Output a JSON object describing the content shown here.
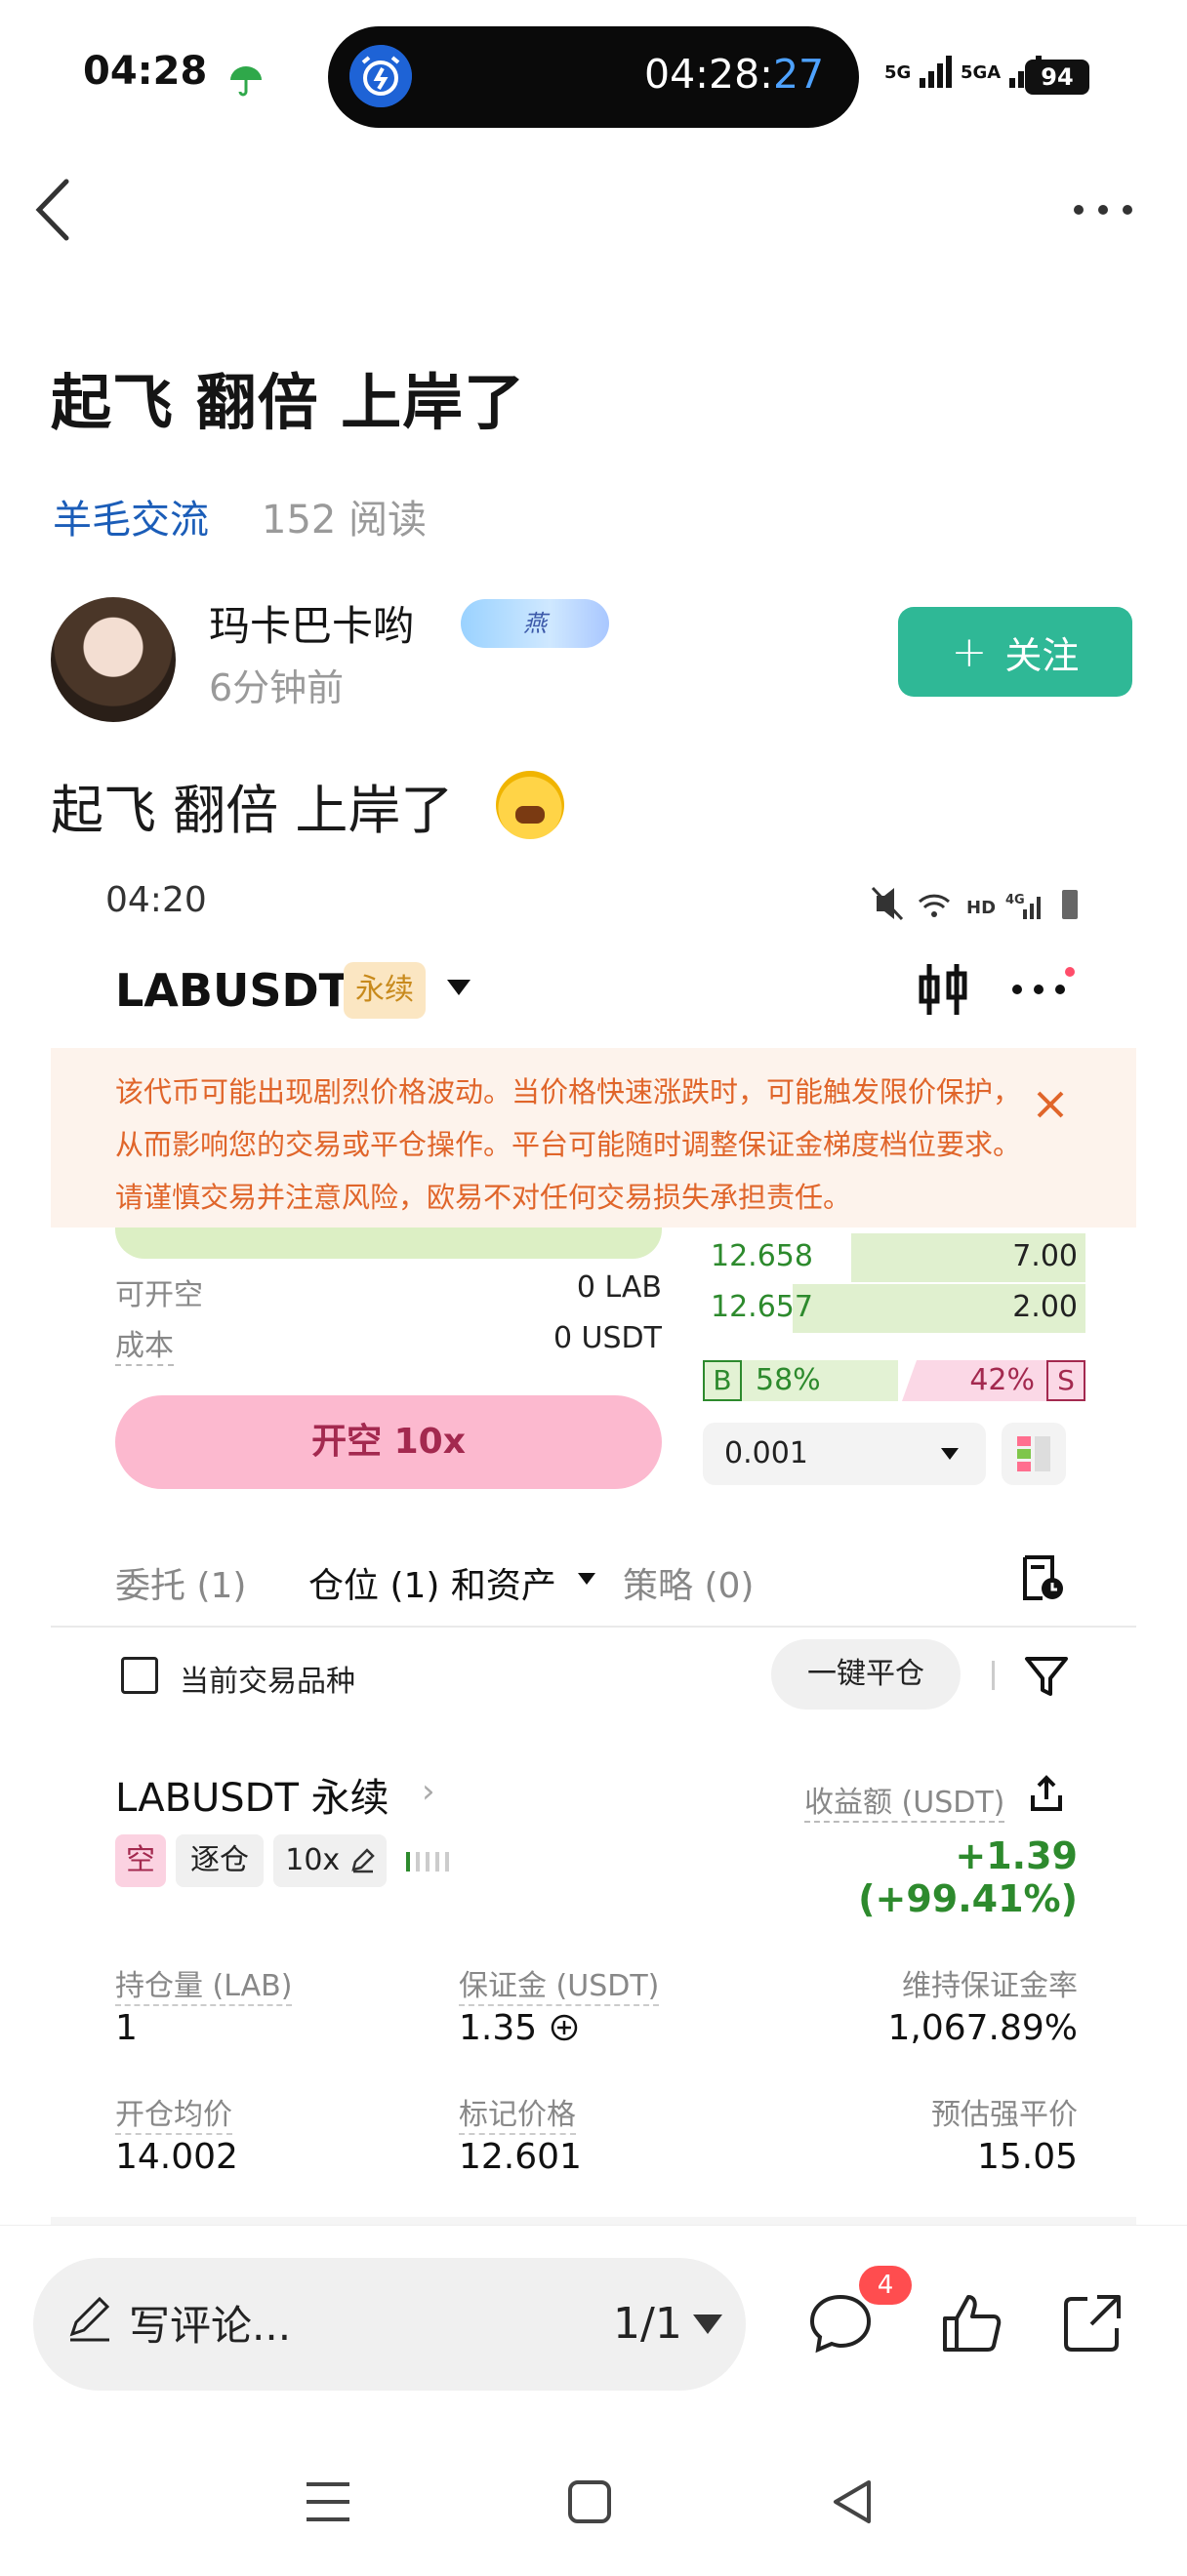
{
  "status_bar": {
    "time": "04:28",
    "island_time_prefix": "04:28:",
    "island_time_seconds": "27",
    "signal_1": "5G",
    "signal_2": "5GA",
    "battery": "94"
  },
  "post": {
    "title": "起飞 翻倍 上岸了",
    "category": "羊毛交流",
    "reads": "152 阅读",
    "author": "玛卡巴卡哟",
    "author_badge": "燕",
    "time_ago": "6分钟前",
    "follow_label": "关注",
    "body": "起飞 翻倍 上岸了"
  },
  "screenshot": {
    "time": "04:20",
    "pair": "LABUSDT",
    "perp_tag": "永续",
    "warning": "该代币可能出现剧烈价格波动。当价格快速涨跌时，可能触发限价保护，从而影响您的交易或平仓操作。平台可能随时调整保证金梯度档位要求。请谨慎交易并注意风险，欧易不对任何交易损失承担责任。",
    "orderbook": [
      {
        "price": "12.658",
        "qty": "7.00",
        "depth": 0.45
      },
      {
        "price": "12.657",
        "qty": "2.00",
        "depth": 0.6
      }
    ],
    "available_short_label": "可开空",
    "available_short_value": "0 LAB",
    "cost_label": "成本",
    "cost_value": "0 USDT",
    "short_button": "开空 10x",
    "buy_label": "B",
    "buy_pct": "58%",
    "sell_pct": "42%",
    "sell_label": "S",
    "qty_value": "0.001",
    "tabs": [
      "委托 (1)",
      "仓位 (1) 和资产",
      "策略 (0)"
    ],
    "current_pair_only": "当前交易品种",
    "close_all": "一键平仓",
    "position": {
      "title": "LABUSDT 永续",
      "pnl_label": "收益额 (USDT)",
      "tag_side": "空",
      "tag_margin": "逐仓",
      "tag_leverage": "10x",
      "pnl_value": "+1.39 (+99.41%)",
      "fields": [
        {
          "label": "持仓量 (LAB)",
          "value": "1"
        },
        {
          "label": "保证金 (USDT)",
          "value": "1.35"
        },
        {
          "label": "维持保证金率",
          "value": "1,067.89%"
        },
        {
          "label": "开仓均价",
          "value": "14.002"
        },
        {
          "label": "标记价格",
          "value": "12.601"
        },
        {
          "label": "预估强平价",
          "value": "15.05"
        }
      ]
    }
  },
  "bottom_bar": {
    "comment_placeholder": "写评论...",
    "page": "1/1",
    "comment_count": "4"
  },
  "colors": {
    "accent_green": "#2fb896",
    "link_blue": "#1b5db8",
    "profit_green": "#2d8a2d",
    "short_pink": "#fcb9cf",
    "warning_orange": "#e0652a"
  }
}
